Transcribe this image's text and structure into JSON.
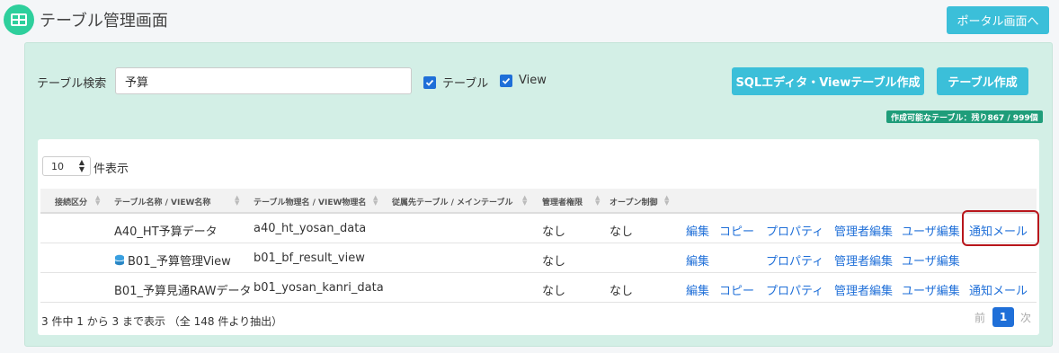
{
  "header": {
    "title": "テーブル管理画面",
    "portal_button": "ポータル画面へ"
  },
  "search": {
    "label": "テーブル検索",
    "value": "予算",
    "checkbox_table": "テーブル",
    "checkbox_view": "View",
    "sql_editor_button": "SQLエディタ・Viewテーブル作成",
    "create_table_button": "テーブル作成",
    "quota_badge": "作成可能なテーブル：残り867 / 999個"
  },
  "table": {
    "length_value": "10",
    "length_label": "件表示",
    "columns": [
      "接続区分",
      "テーブル名称 / VIEW名称",
      "テーブル物理名 / VIEW物理名",
      "従属先テーブル / メインテーブル",
      "管理者権限",
      "オープン制御"
    ],
    "rows": [
      {
        "conn": "",
        "name": "A40_HT予算データ",
        "physical": "a40_ht_yosan_data",
        "parent": "",
        "admin": "なし",
        "open": "なし",
        "is_view": false,
        "actions": {
          "edit": "編集",
          "copy": "コピー",
          "property": "プロパティ",
          "admin_edit": "管理者編集",
          "user_edit": "ユーザ編集",
          "notify": "通知メール"
        }
      },
      {
        "conn": "",
        "name": "B01_予算管理View",
        "physical": "b01_bf_result_view",
        "parent": "",
        "admin": "なし",
        "open": "",
        "is_view": true,
        "actions": {
          "edit": "編集",
          "copy": "",
          "property": "プロパティ",
          "admin_edit": "管理者編集",
          "user_edit": "ユーザ編集",
          "notify": ""
        }
      },
      {
        "conn": "",
        "name": "B01_予算見通RAWデータ",
        "physical": "b01_yosan_kanri_data",
        "parent": "",
        "admin": "なし",
        "open": "なし",
        "is_view": false,
        "actions": {
          "edit": "編集",
          "copy": "コピー",
          "property": "プロパティ",
          "admin_edit": "管理者編集",
          "user_edit": "ユーザ編集",
          "notify": "通知メール"
        }
      }
    ],
    "info": "3 件中 1 から 3 まで表示 （全 148 件より抽出）",
    "pagination": {
      "prev": "前",
      "current": "1",
      "next": "次"
    }
  },
  "colors": {
    "accent": "#3bbfd9",
    "panel": "#d3efe6",
    "link": "#1f6fd8",
    "badge": "#1f9d7a",
    "highlight": "#b8161c"
  }
}
